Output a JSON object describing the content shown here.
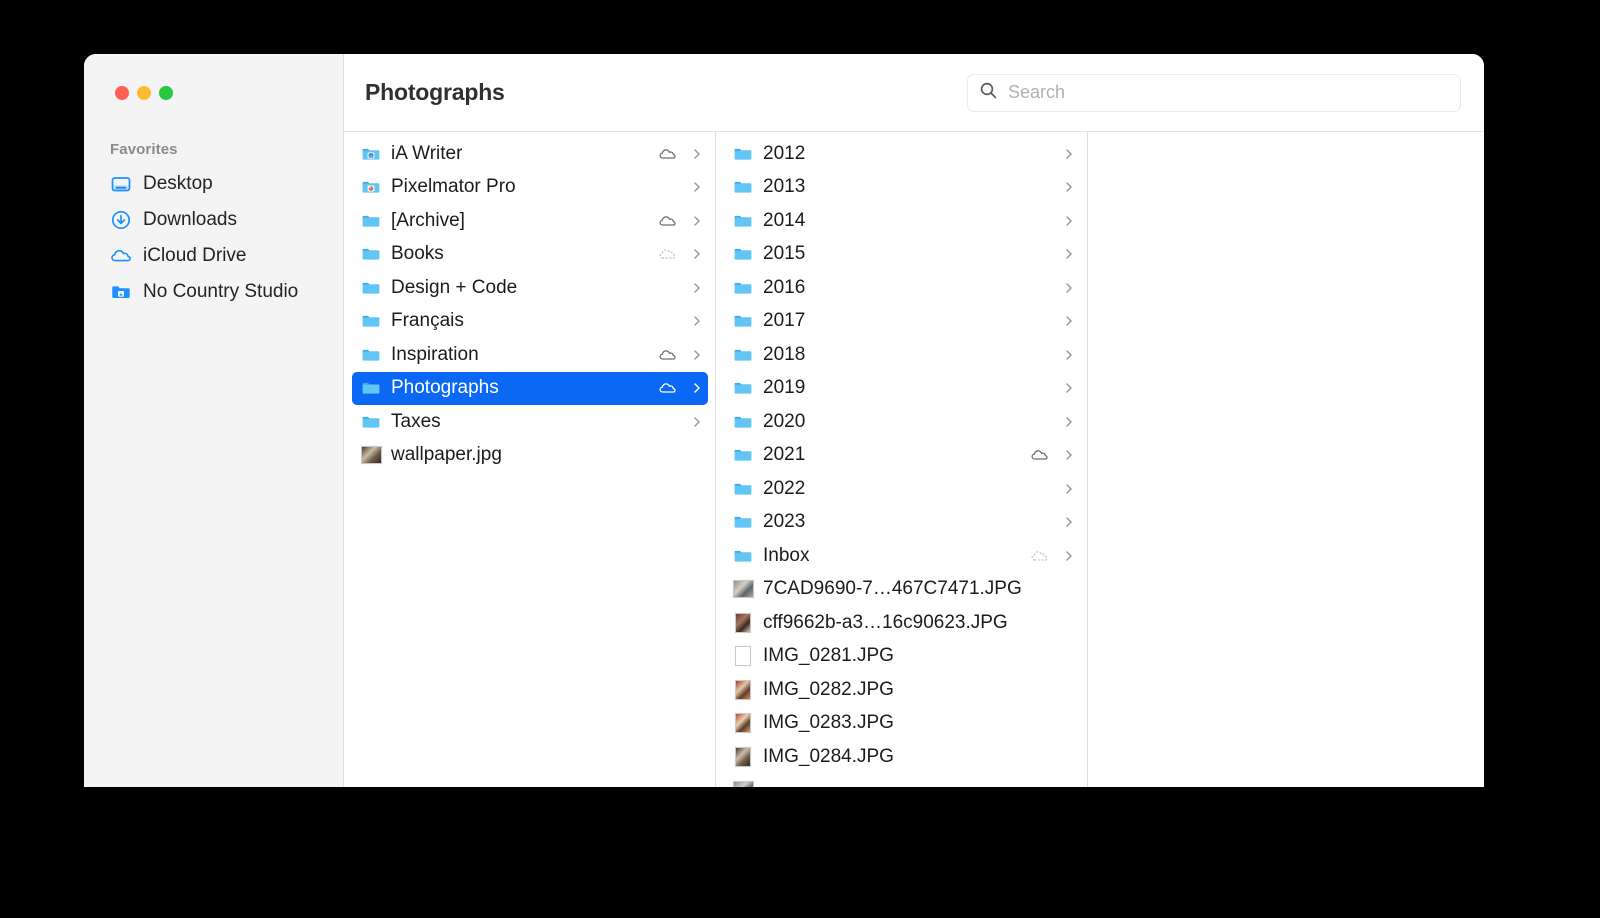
{
  "window": {
    "title": "Photographs",
    "traffic_lights": [
      {
        "name": "close-button",
        "color": "#ff5f57"
      },
      {
        "name": "minimize-button",
        "color": "#febc2e"
      },
      {
        "name": "maximize-button",
        "color": "#28c840"
      }
    ]
  },
  "search": {
    "placeholder": "Search",
    "value": "",
    "icon": "search-icon"
  },
  "sidebar": {
    "section_title": "Favorites",
    "items": [
      {
        "label": "Desktop",
        "icon": "desktop-icon"
      },
      {
        "label": "Downloads",
        "icon": "downloads-icon"
      },
      {
        "label": "iCloud Drive",
        "icon": "icloud-drive-icon"
      },
      {
        "label": "No Country Studio",
        "icon": "folder-badge-icon"
      }
    ]
  },
  "colors": {
    "selection": "#0a68f5",
    "sidebar_bg": "#f4f4f4",
    "folder_blue": "#54c0f2"
  },
  "columns": [
    {
      "name": "column-documents",
      "items": [
        {
          "label": "iA Writer",
          "icon": "folder-app-iawriter-icon",
          "cloud": "solid",
          "chevron": true,
          "selected": false
        },
        {
          "label": "Pixelmator Pro",
          "icon": "folder-app-pixelmator-icon",
          "cloud": "none",
          "chevron": true,
          "selected": false
        },
        {
          "label": "[Archive]",
          "icon": "folder-icon",
          "cloud": "solid",
          "chevron": true,
          "selected": false
        },
        {
          "label": "Books",
          "icon": "folder-icon",
          "cloud": "dashed",
          "chevron": true,
          "selected": false
        },
        {
          "label": "Design + Code",
          "icon": "folder-icon",
          "cloud": "none",
          "chevron": true,
          "selected": false
        },
        {
          "label": "Français",
          "icon": "folder-icon",
          "cloud": "none",
          "chevron": true,
          "selected": false
        },
        {
          "label": "Inspiration",
          "icon": "folder-icon",
          "cloud": "solid",
          "chevron": true,
          "selected": false
        },
        {
          "label": "Photographs",
          "icon": "folder-icon",
          "cloud": "solid",
          "chevron": true,
          "selected": true
        },
        {
          "label": "Taxes",
          "icon": "folder-icon",
          "cloud": "none",
          "chevron": true,
          "selected": false
        },
        {
          "label": "wallpaper.jpg",
          "icon": "image-thumbnail-icon",
          "cloud": "none",
          "chevron": false,
          "selected": false
        }
      ]
    },
    {
      "name": "column-photographs",
      "items": [
        {
          "label": "2012",
          "icon": "folder-icon",
          "cloud": "none",
          "chevron": true,
          "selected": false
        },
        {
          "label": "2013",
          "icon": "folder-icon",
          "cloud": "none",
          "chevron": true,
          "selected": false
        },
        {
          "label": "2014",
          "icon": "folder-icon",
          "cloud": "none",
          "chevron": true,
          "selected": false
        },
        {
          "label": "2015",
          "icon": "folder-icon",
          "cloud": "none",
          "chevron": true,
          "selected": false
        },
        {
          "label": "2016",
          "icon": "folder-icon",
          "cloud": "none",
          "chevron": true,
          "selected": false
        },
        {
          "label": "2017",
          "icon": "folder-icon",
          "cloud": "none",
          "chevron": true,
          "selected": false
        },
        {
          "label": "2018",
          "icon": "folder-icon",
          "cloud": "none",
          "chevron": true,
          "selected": false
        },
        {
          "label": "2019",
          "icon": "folder-icon",
          "cloud": "none",
          "chevron": true,
          "selected": false
        },
        {
          "label": "2020",
          "icon": "folder-icon",
          "cloud": "none",
          "chevron": true,
          "selected": false
        },
        {
          "label": "2021",
          "icon": "folder-icon",
          "cloud": "solid",
          "chevron": true,
          "selected": false
        },
        {
          "label": "2022",
          "icon": "folder-icon",
          "cloud": "none",
          "chevron": true,
          "selected": false
        },
        {
          "label": "2023",
          "icon": "folder-icon",
          "cloud": "none",
          "chevron": true,
          "selected": false
        },
        {
          "label": "Inbox",
          "icon": "folder-icon",
          "cloud": "dashed",
          "chevron": true,
          "selected": false
        },
        {
          "label": "7CAD9690-7…467C7471.JPG",
          "icon": "image-thumbnail-icon",
          "cloud": "none",
          "chevron": false,
          "selected": false
        },
        {
          "label": "cff9662b-a3…16c90623.JPG",
          "icon": "image-thumbnail-icon",
          "cloud": "none",
          "chevron": false,
          "selected": false
        },
        {
          "label": "IMG_0281.JPG",
          "icon": "image-thumbnail-icon",
          "cloud": "none",
          "chevron": false,
          "selected": false
        },
        {
          "label": "IMG_0282.JPG",
          "icon": "image-thumbnail-icon",
          "cloud": "none",
          "chevron": false,
          "selected": false
        },
        {
          "label": "IMG_0283.JPG",
          "icon": "image-thumbnail-icon",
          "cloud": "none",
          "chevron": false,
          "selected": false
        },
        {
          "label": "IMG_0284.JPG",
          "icon": "image-thumbnail-icon",
          "cloud": "none",
          "chevron": false,
          "selected": false
        },
        {
          "label": "",
          "icon": "image-thumbnail-icon",
          "cloud": "none",
          "chevron": false,
          "selected": false
        }
      ]
    },
    {
      "name": "column-preview",
      "items": []
    }
  ]
}
